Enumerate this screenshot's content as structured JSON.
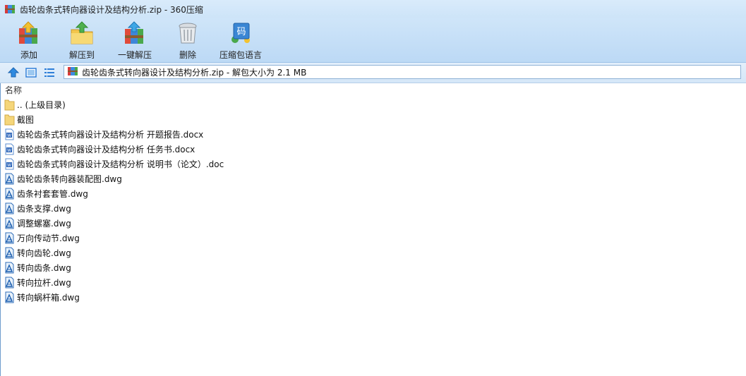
{
  "window": {
    "title": "齿轮齿条式转向器设计及结构分析.zip - 360压缩"
  },
  "toolbar": {
    "add_label": "添加",
    "extract_to_label": "解压到",
    "one_click_extract_label": "一键解压",
    "delete_label": "删除",
    "encoding_label": "压缩包语言",
    "encoding_icon_text": "码"
  },
  "address": {
    "text": "齿轮齿条式转向器设计及结构分析.zip - 解包大小为 2.1 MB"
  },
  "list": {
    "header_name": "名称",
    "items": [
      {
        "name": ".. (上级目录)",
        "type": "folder"
      },
      {
        "name": "截图",
        "type": "folder"
      },
      {
        "name": "齿轮齿条式转向器设计及结构分析 开题报告.docx",
        "type": "word"
      },
      {
        "name": "齿轮齿条式转向器设计及结构分析 任务书.docx",
        "type": "word"
      },
      {
        "name": "齿轮齿条式转向器设计及结构分析 说明书（论文）.doc",
        "type": "word"
      },
      {
        "name": "齿轮齿条转向器装配图.dwg",
        "type": "dwg"
      },
      {
        "name": "齿条衬套套管.dwg",
        "type": "dwg"
      },
      {
        "name": "齿条支撑.dwg",
        "type": "dwg"
      },
      {
        "name": "调整螺塞.dwg",
        "type": "dwg"
      },
      {
        "name": "万向传动节.dwg",
        "type": "dwg"
      },
      {
        "name": "转向齿轮.dwg",
        "type": "dwg"
      },
      {
        "name": "转向齿条.dwg",
        "type": "dwg"
      },
      {
        "name": "转向拉杆.dwg",
        "type": "dwg"
      },
      {
        "name": "转向蜗杆箱.dwg",
        "type": "dwg"
      }
    ]
  },
  "colors": {
    "accent": "#2f7fd8",
    "folder": "#f5d67a",
    "toolbar_bg": "#c6dff7"
  }
}
